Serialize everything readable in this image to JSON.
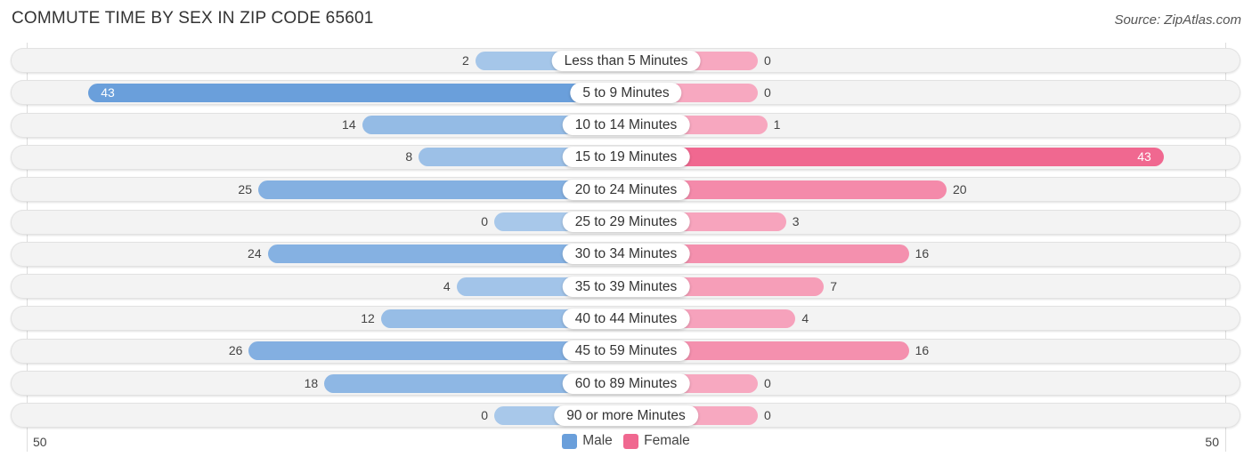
{
  "header": {
    "title": "COMMUTE TIME BY SEX IN ZIP CODE 65601",
    "source": "Source: ZipAtlas.com"
  },
  "colors": {
    "male_strong": "#6a9fdb",
    "male_light": "#a8c8ea",
    "female_strong": "#f06890",
    "female_light": "#f7a8c0"
  },
  "chart_data": {
    "type": "bar",
    "orientation": "horizontal-diverging",
    "title": "COMMUTE TIME BY SEX IN ZIP CODE 65601",
    "categories": [
      "Less than 5 Minutes",
      "5 to 9 Minutes",
      "10 to 14 Minutes",
      "15 to 19 Minutes",
      "20 to 24 Minutes",
      "25 to 29 Minutes",
      "30 to 34 Minutes",
      "35 to 39 Minutes",
      "40 to 44 Minutes",
      "45 to 59 Minutes",
      "60 to 89 Minutes",
      "90 or more Minutes"
    ],
    "series": [
      {
        "name": "Male",
        "values": [
          2,
          43,
          14,
          8,
          25,
          0,
          24,
          4,
          12,
          26,
          18,
          0
        ]
      },
      {
        "name": "Female",
        "values": [
          0,
          0,
          1,
          43,
          20,
          3,
          16,
          7,
          4,
          16,
          0,
          0
        ]
      }
    ],
    "axis": {
      "left_tick": "50",
      "right_tick": "50",
      "range": [
        0,
        50
      ]
    },
    "legend": {
      "position": "bottom-center",
      "items": [
        "Male",
        "Female"
      ]
    },
    "xlabel": "",
    "ylabel": ""
  }
}
